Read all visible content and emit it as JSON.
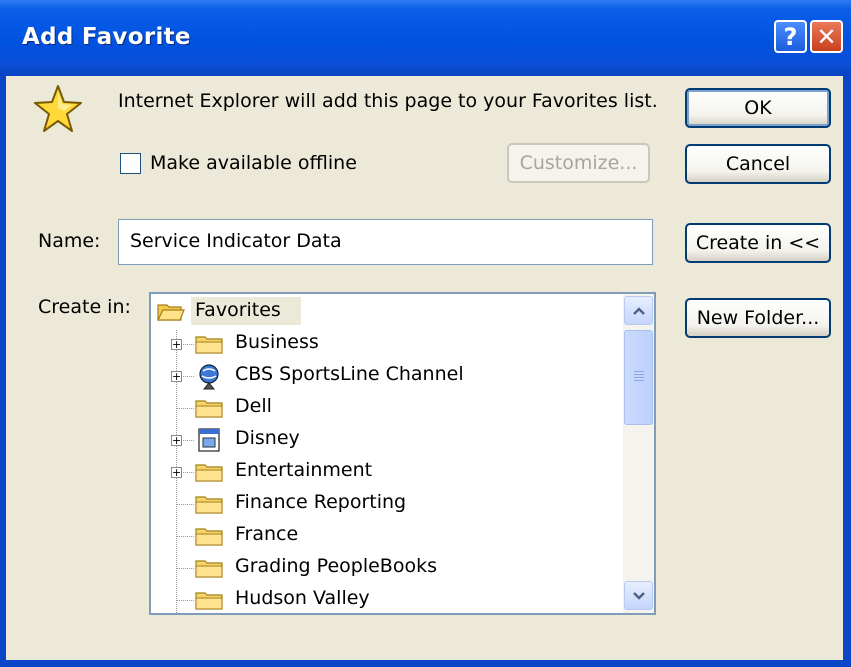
{
  "window": {
    "title": "Add Favorite",
    "help_symbol": "?",
    "close_symbol": "✕"
  },
  "message": "Internet Explorer will add this page to your Favorites list.",
  "offline_label": "Make available offline",
  "buttons": {
    "ok": "OK",
    "cancel": "Cancel",
    "customize": "Customize...",
    "create_in": "Create in <<",
    "new_folder": "New Folder..."
  },
  "name_label": "Name:",
  "name_value": "Service Indicator Data",
  "create_in_label": "Create in:",
  "tree": {
    "root": "Favorites",
    "items": [
      {
        "label": "Business",
        "icon": "folder-icon",
        "expandable": true
      },
      {
        "label": "CBS SportsLine Channel",
        "icon": "channel-icon",
        "expandable": true
      },
      {
        "label": "Dell",
        "icon": "folder-icon",
        "expandable": false
      },
      {
        "label": "Disney",
        "icon": "channel-page-icon",
        "expandable": true
      },
      {
        "label": "Entertainment",
        "icon": "folder-icon",
        "expandable": true
      },
      {
        "label": "Finance Reporting",
        "icon": "folder-icon",
        "expandable": false
      },
      {
        "label": "France",
        "icon": "folder-icon",
        "expandable": false
      },
      {
        "label": "Grading PeopleBooks",
        "icon": "folder-icon",
        "expandable": false
      },
      {
        "label": "Hudson Valley",
        "icon": "folder-icon",
        "expandable": false
      }
    ]
  },
  "colors": {
    "titlebar": "#0052e0",
    "dialog_face": "#ece9d8",
    "button_border": "#003c74"
  }
}
